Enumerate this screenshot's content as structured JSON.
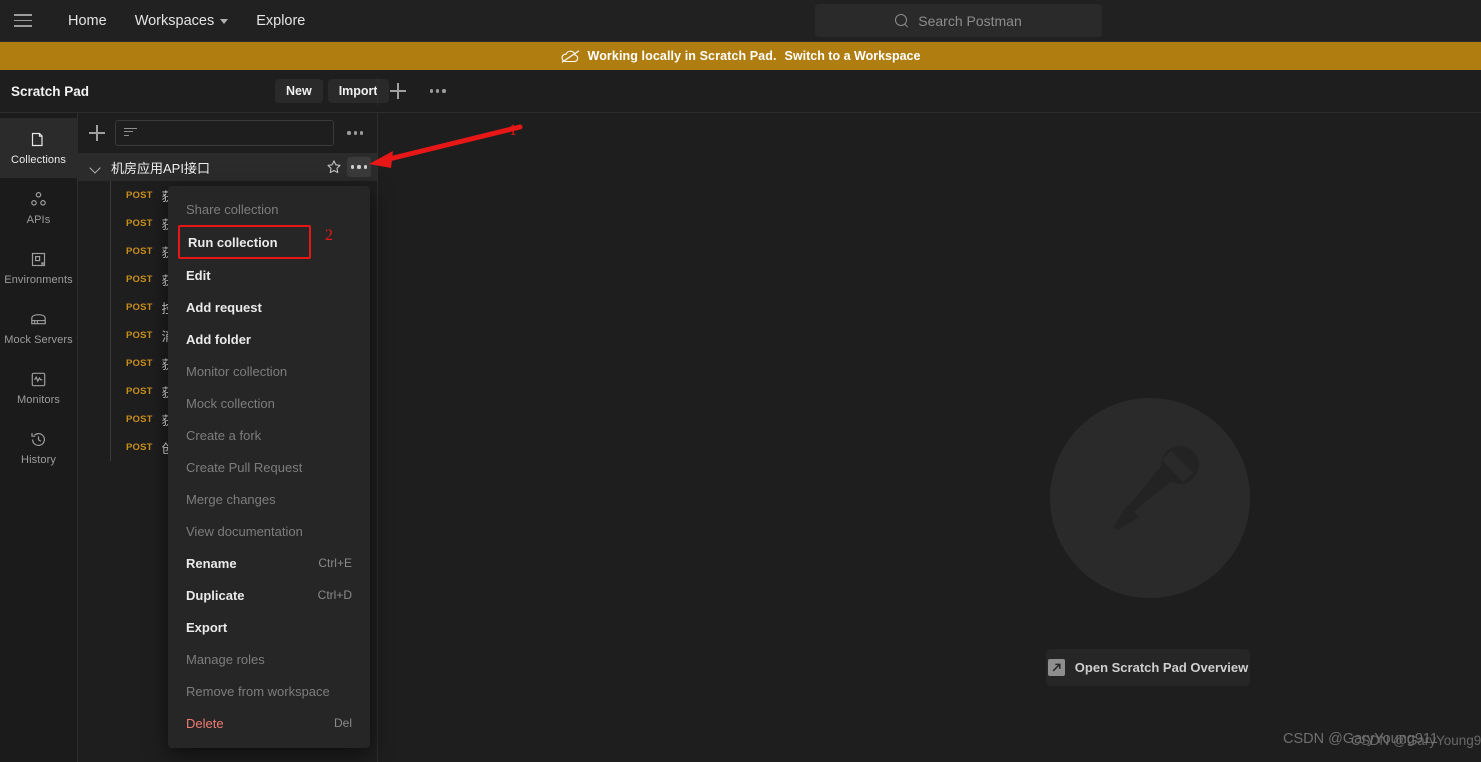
{
  "topbar": {
    "menu_icon": "hamburger-icon",
    "nav": [
      {
        "label": "Home",
        "has_caret": false
      },
      {
        "label": "Workspaces",
        "has_caret": true
      },
      {
        "label": "Explore",
        "has_caret": false
      }
    ],
    "search": {
      "icon": "search-icon",
      "placeholder": "Search Postman"
    }
  },
  "banner": {
    "icon": "cloud-off-icon",
    "text": "Working locally in Scratch Pad.",
    "link": "Switch to a Workspace",
    "bg_color": "#b07d10",
    "text_color": "#ffffff"
  },
  "workspace_header": {
    "title": "Scratch Pad",
    "new_label": "New",
    "import_label": "Import",
    "plus_icon": "plus-icon",
    "more_icon": "more-horizontal-icon"
  },
  "rail": {
    "items": [
      {
        "label": "Collections",
        "icon": "collections-icon",
        "active": true
      },
      {
        "label": "APIs",
        "icon": "apis-icon",
        "active": false
      },
      {
        "label": "Environments",
        "icon": "environments-icon",
        "active": false
      },
      {
        "label": "Mock Servers",
        "icon": "mock-servers-icon",
        "active": false
      },
      {
        "label": "Monitors",
        "icon": "monitors-icon",
        "active": false
      },
      {
        "label": "History",
        "icon": "history-icon",
        "active": false
      }
    ]
  },
  "sidebar": {
    "toolbar": {
      "plus_icon": "plus-icon",
      "filter_icon": "filter-icon",
      "filter_placeholder": "",
      "more_icon": "more-horizontal-icon"
    },
    "collection": {
      "name": "机房应用API接口",
      "expanded": true,
      "chevron_icon": "chevron-down-icon",
      "star_icon": "star-icon",
      "more_icon": "more-horizontal-icon"
    },
    "requests": [
      {
        "method": "POST",
        "name": "获"
      },
      {
        "method": "POST",
        "name": "获"
      },
      {
        "method": "POST",
        "name": "获"
      },
      {
        "method": "POST",
        "name": "获"
      },
      {
        "method": "POST",
        "name": "控"
      },
      {
        "method": "POST",
        "name": "消"
      },
      {
        "method": "POST",
        "name": "获"
      },
      {
        "method": "POST",
        "name": "获"
      },
      {
        "method": "POST",
        "name": "获"
      },
      {
        "method": "POST",
        "name": "创"
      }
    ]
  },
  "context_menu": {
    "items": [
      {
        "label": "Share collection",
        "shortcut": "",
        "state": "disabled"
      },
      {
        "label": "Run collection",
        "shortcut": "",
        "state": "highlighted"
      },
      {
        "label": "Edit",
        "shortcut": "",
        "state": "enabled"
      },
      {
        "label": "Add request",
        "shortcut": "",
        "state": "enabled"
      },
      {
        "label": "Add folder",
        "shortcut": "",
        "state": "enabled"
      },
      {
        "label": "Monitor collection",
        "shortcut": "",
        "state": "disabled"
      },
      {
        "label": "Mock collection",
        "shortcut": "",
        "state": "disabled"
      },
      {
        "label": "Create a fork",
        "shortcut": "",
        "state": "disabled"
      },
      {
        "label": "Create Pull Request",
        "shortcut": "",
        "state": "disabled"
      },
      {
        "label": "Merge changes",
        "shortcut": "",
        "state": "disabled"
      },
      {
        "label": "View documentation",
        "shortcut": "",
        "state": "disabled"
      },
      {
        "label": "Rename",
        "shortcut": "Ctrl+E",
        "state": "enabled"
      },
      {
        "label": "Duplicate",
        "shortcut": "Ctrl+D",
        "state": "enabled"
      },
      {
        "label": "Export",
        "shortcut": "",
        "state": "enabled"
      },
      {
        "label": "Manage roles",
        "shortcut": "",
        "state": "disabled"
      },
      {
        "label": "Remove from workspace",
        "shortcut": "",
        "state": "disabled"
      },
      {
        "label": "Delete",
        "shortcut": "Del",
        "state": "danger"
      }
    ],
    "highlight_color": "#e81717"
  },
  "main": {
    "logo_icon": "postman-logo-icon",
    "overview_button": {
      "label": "Open Scratch Pad Overview",
      "icon": "external-link-icon"
    }
  },
  "annotations": {
    "arrow_color": "#e81717",
    "markers": [
      {
        "label": "1",
        "target": "collection-more-button"
      },
      {
        "label": "2",
        "target": "run-collection-menu-item"
      }
    ]
  },
  "watermark": {
    "primary": "CSDN @GaryYoung911",
    "overlay": "CSDN @GaryYoung911"
  }
}
